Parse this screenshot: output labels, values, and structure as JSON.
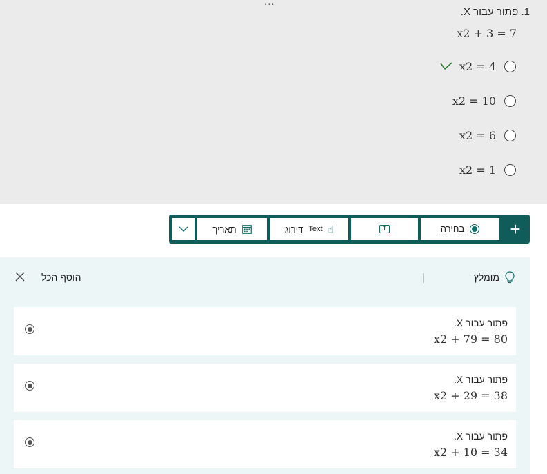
{
  "question": {
    "more_menu": "...",
    "title": "1. פתור עבור X.",
    "equation": "x2 + 3 = 7",
    "options": [
      {
        "text": "x2 = 4",
        "correct": true
      },
      {
        "text": "x2 = 10",
        "correct": false
      },
      {
        "text": "x2 = 6",
        "correct": false
      },
      {
        "text": "x2 = 1",
        "correct": false
      }
    ]
  },
  "toolbar": {
    "add_label": "+",
    "choice_label": "בחירה",
    "text_icon": "T",
    "rating_label": "דירוג",
    "rating_overlay": "Text",
    "date_label": "תאריך"
  },
  "suggestions": {
    "header": "מומלץ",
    "add_all": "הוסף הכל",
    "items": [
      {
        "title": "פתור עבור X.",
        "equation": "x2 + 79 = 80"
      },
      {
        "title": "פתור עבור X.",
        "equation": "x2 + 29 = 38"
      },
      {
        "title": "פתור עבור X.",
        "equation": "x2 + 10 = 34"
      }
    ]
  },
  "colors": {
    "accent": "#0f5c5b",
    "panel_bg": "#edf6f7",
    "question_bg": "#ebebeb",
    "correct": "#2e7d32"
  }
}
